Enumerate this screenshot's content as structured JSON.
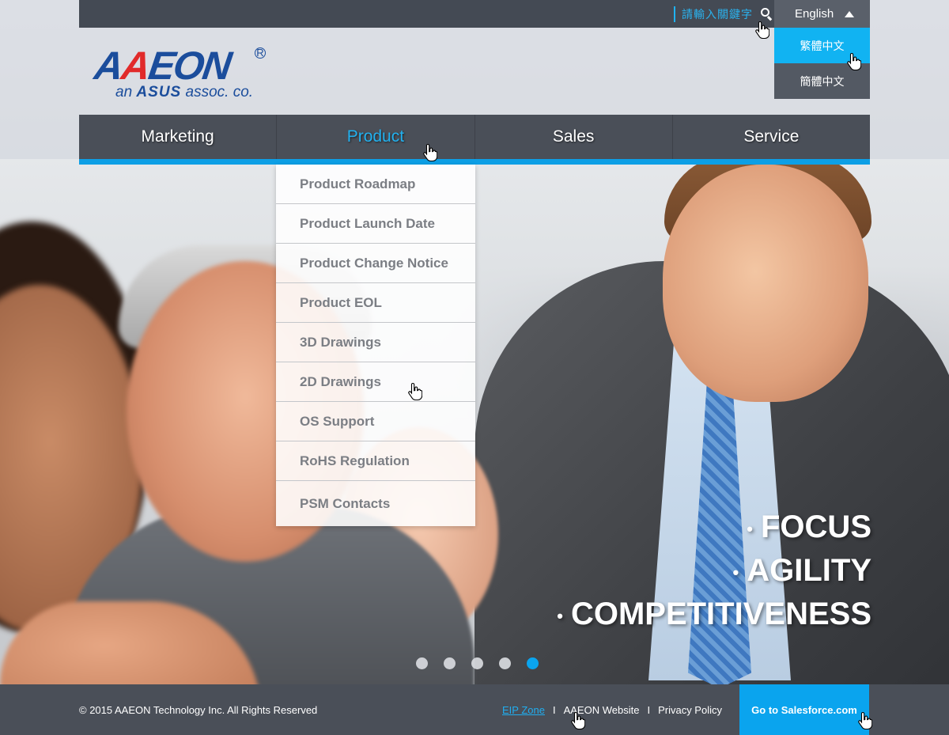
{
  "search": {
    "placeholder": "請輸入關鍵字",
    "icon": "search-icon"
  },
  "language": {
    "current": "English",
    "options": [
      {
        "label": "繁體中文",
        "active": true
      },
      {
        "label": "簡體中文",
        "active": false
      }
    ]
  },
  "logo": {
    "wordmark_a1": "A",
    "wordmark_a2": "A",
    "wordmark_rest": "EON",
    "registered": "R",
    "tagline_prefix": "an ",
    "tagline_brand": "ASUS",
    "tagline_suffix": " assoc. co."
  },
  "nav": {
    "items": [
      {
        "label": "Marketing",
        "active": false
      },
      {
        "label": "Product",
        "active": true
      },
      {
        "label": "Sales",
        "active": false
      },
      {
        "label": "Service",
        "active": false
      }
    ]
  },
  "product_menu": {
    "items": [
      "Product Roadmap",
      "Product Launch Date",
      "Product Change Notice",
      "Product EOL",
      "3D Drawings",
      "2D Drawings",
      "OS Support",
      "RoHS  Regulation",
      "PSM Contacts"
    ]
  },
  "slogan": {
    "bullet": "•",
    "lines": [
      "FOCUS",
      "AGILITY",
      "COMPETITIVENESS"
    ]
  },
  "carousel": {
    "count": 5,
    "active_index": 4
  },
  "footer": {
    "copyright": "© 2015 AAEON Technology Inc. All Rights Reserved",
    "links": [
      "EIP Zone",
      "AAEON Website",
      "Privacy Policy"
    ],
    "separator": "I",
    "cta": "Go to Salesforce.com"
  },
  "colors": {
    "accent": "#0aa4ee",
    "bar": "#4a4f58",
    "brand_blue": "#1b4d9c",
    "brand_red": "#e12a2a"
  }
}
